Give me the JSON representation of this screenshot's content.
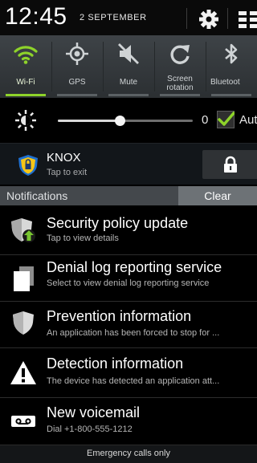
{
  "status_bar": {
    "time": "12:45",
    "date": "2 SEPTEMBER",
    "icons": [
      "settings-icon",
      "grid-icon"
    ]
  },
  "quick_settings": {
    "toggles": [
      {
        "label": "Wi-Fi",
        "icon": "wifi-icon",
        "on": true
      },
      {
        "label": "GPS",
        "icon": "gps-icon",
        "on": false
      },
      {
        "label": "Mute",
        "icon": "mute-icon",
        "on": false
      },
      {
        "label": "Screen rotation",
        "icon": "rotation-icon",
        "on": false
      },
      {
        "label": "Bluetoot",
        "icon": "bluetooth-icon",
        "on": false
      }
    ],
    "accent_color": "#8ed32a"
  },
  "brightness": {
    "icon": "brightness-icon",
    "value": "0",
    "level": 0.46,
    "auto_label": "Aut",
    "auto_checked": true
  },
  "knox": {
    "title": "KNOX",
    "subtitle": "Tap to exit",
    "icon": "knox-shield-icon",
    "lock_icon": "lock-icon"
  },
  "notifications_header": {
    "label": "Notifications",
    "clear_label": "Clear"
  },
  "notifications": [
    {
      "title": "Security policy update",
      "subtitle": "Tap to view details",
      "icon": "security-update-icon"
    },
    {
      "title": "Denial log reporting service",
      "subtitle": "Select to view denial log reporting service",
      "icon": "documents-icon"
    },
    {
      "title": "Prevention information",
      "subtitle": "An application has been forced to stop for ...",
      "icon": "shield-icon"
    },
    {
      "title": "Detection information",
      "subtitle": "The device has detected an application att...",
      "icon": "warning-icon"
    },
    {
      "title": "New voicemail",
      "subtitle": "Dial +1-800-555-1212",
      "icon": "voicemail-icon"
    }
  ],
  "footer": {
    "text": "Emergency calls only"
  }
}
